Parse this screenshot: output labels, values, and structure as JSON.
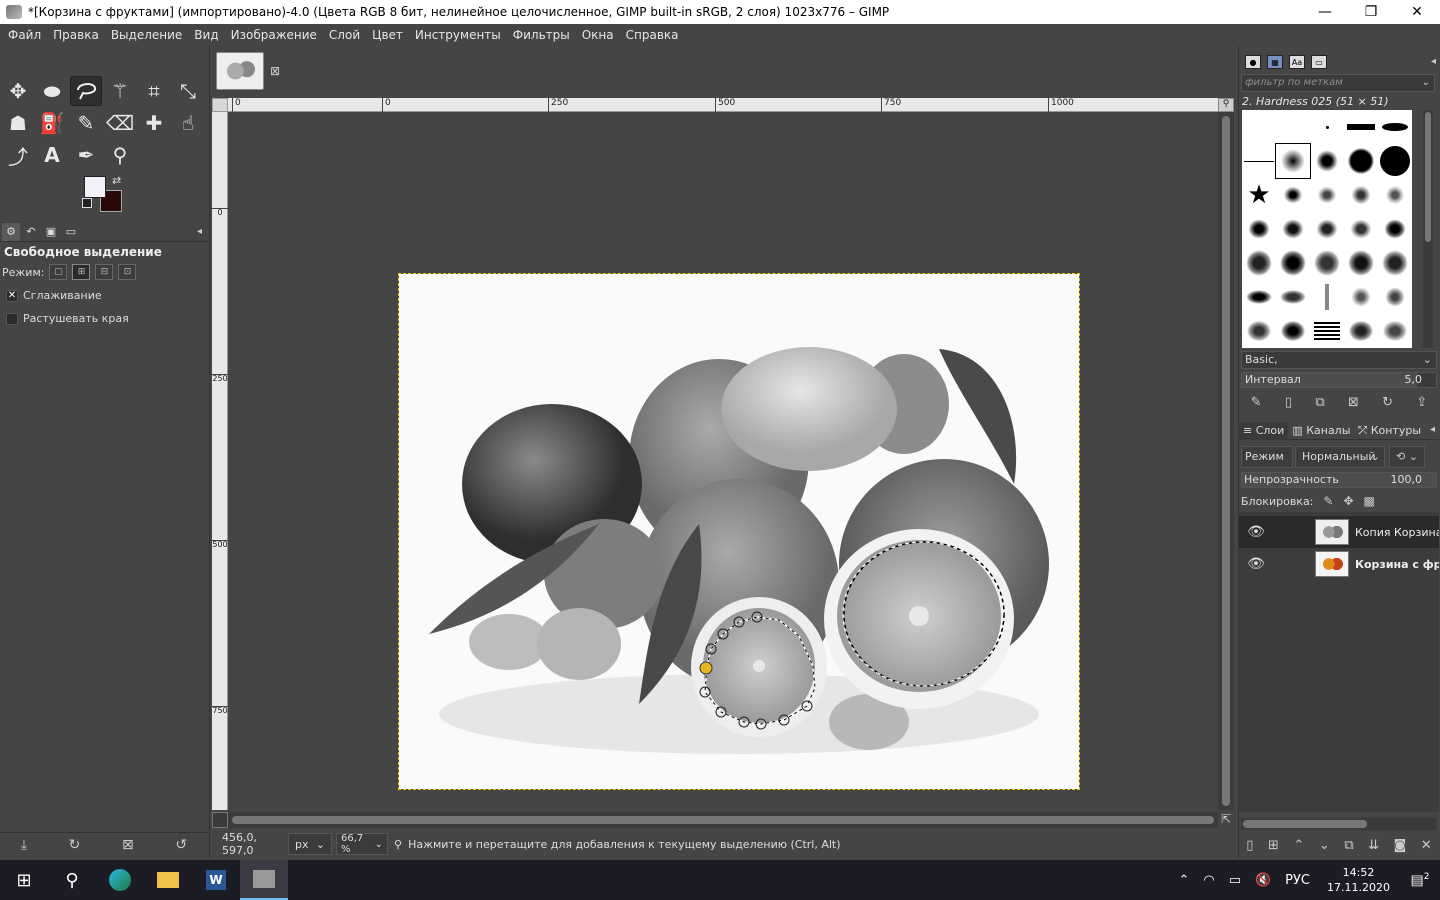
{
  "window": {
    "title": "*[Корзина с фруктами] (импортировано)-4.0 (Цвета RGB 8 бит, нелинейное целочисленное, GIMP built-in sRGB, 2 слоя) 1023x776 – GIMP",
    "minimize": "—",
    "maximize": "❐",
    "close": "✕"
  },
  "menu": [
    "Файл",
    "Правка",
    "Выделение",
    "Вид",
    "Изображение",
    "Слой",
    "Цвет",
    "Инструменты",
    "Фильтры",
    "Окна",
    "Справка"
  ],
  "toolbox": {
    "tool_options_title": "Свободное выделение",
    "mode_label": "Режим:",
    "antialias_label": "Сглаживание",
    "antialias_checked": true,
    "feather_label": "Растушевать края",
    "feather_checked": false,
    "fg_color": "#f2f2f8",
    "bg_color": "#2a0808"
  },
  "canvas": {
    "hruler_ticks": [
      "0",
      "0",
      "250",
      "500",
      "750",
      "1000"
    ],
    "vruler_ticks": [
      "0",
      "250",
      "500",
      "750"
    ]
  },
  "status": {
    "coords": "456,0, 597,0",
    "unit": "px",
    "zoom": "66,7 %",
    "hint": "Нажмите и перетащите для добавления к текущему выделению (Ctrl, Alt)"
  },
  "brushes": {
    "filter_placeholder": "фильтр по меткам",
    "selected_brush": "2. Hardness 025 (51 × 51)",
    "preset": "Basic,",
    "interval_label": "Интервал",
    "interval_value": "5,0"
  },
  "layers": {
    "tabs": [
      "Слои",
      "Каналы",
      "Контуры"
    ],
    "mode_label": "Режим",
    "mode_value": "Нормальный",
    "opacity_label": "Непрозрачность",
    "opacity_value": "100,0",
    "lock_label": "Блокировка:",
    "items": [
      {
        "name": "Копия Корзина с фруктами",
        "bold": false
      },
      {
        "name": "Корзина с фруктами",
        "bold": true
      }
    ]
  },
  "taskbar": {
    "language": "РУС",
    "time": "14:52",
    "date": "17.11.2020",
    "notifications": "2"
  }
}
